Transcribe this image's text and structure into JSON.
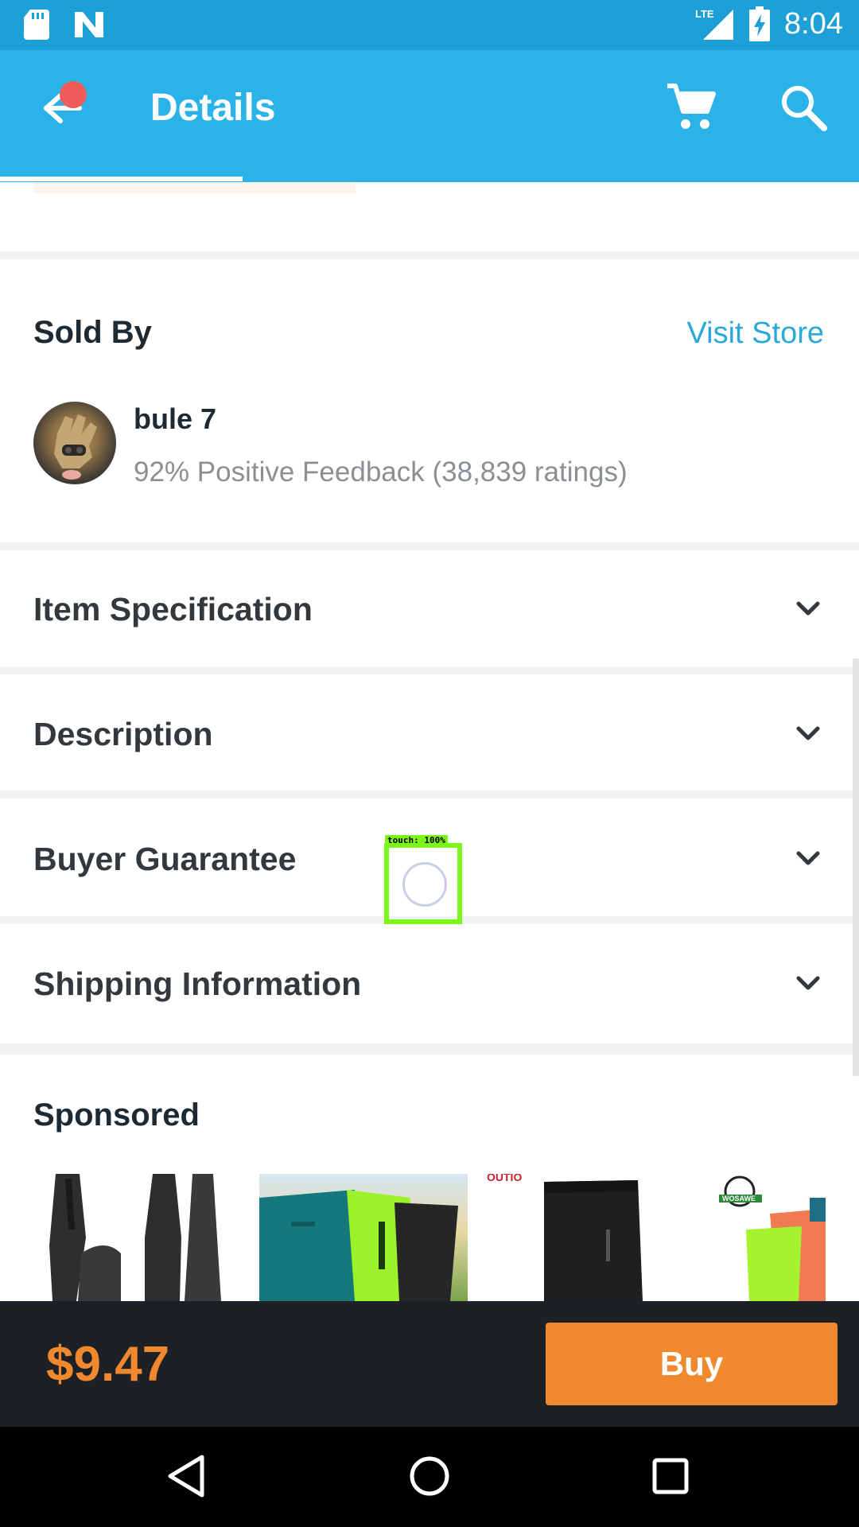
{
  "status_bar": {
    "time": "8:04",
    "network": "LTE",
    "icons": [
      "sd-card-icon",
      "n-notification-icon",
      "signal-icon",
      "battery-charging-icon"
    ]
  },
  "app_bar": {
    "title": "Details",
    "icons": [
      "back-arrow-icon",
      "cart-icon",
      "search-icon"
    ],
    "colors": {
      "bar": "#2bb2e8",
      "status_bar": "#1da0d8",
      "badge": "#f05a5a"
    }
  },
  "seller": {
    "section_title": "Sold By",
    "visit_store_label": "Visit Store",
    "name": "bule 7",
    "feedback": "92% Positive Feedback (38,839 ratings)"
  },
  "sections": [
    {
      "label": "Item Specification"
    },
    {
      "label": "Description"
    },
    {
      "label": "Buyer Guarantee"
    },
    {
      "label": "Shipping Information"
    }
  ],
  "sponsored": {
    "title": "Sponsored",
    "thumb_texts": [
      "",
      "",
      "OUTIO",
      "WOSAWE"
    ]
  },
  "purchase": {
    "price": "$9.47",
    "buy_label": "Buy",
    "colors": {
      "accent": "#f0892e",
      "bar": "#1d2125"
    }
  },
  "touch_overlay": {
    "label": "touch: 100%"
  }
}
